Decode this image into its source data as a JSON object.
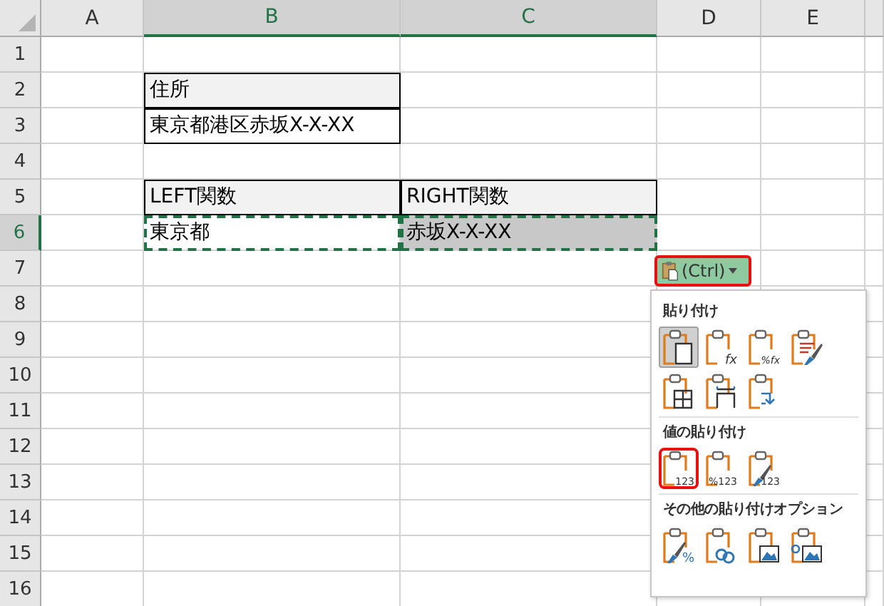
{
  "columns": [
    {
      "label": "A",
      "selected": false
    },
    {
      "label": "B",
      "selected": true
    },
    {
      "label": "C",
      "selected": true
    },
    {
      "label": "D",
      "selected": false
    },
    {
      "label": "E",
      "selected": false
    }
  ],
  "rows": [
    {
      "label": "1",
      "selected": false
    },
    {
      "label": "2",
      "selected": false,
      "cells": [
        {
          "text": "住所",
          "kind": "header",
          "shaded": false,
          "copied": false
        }
      ]
    },
    {
      "label": "3",
      "selected": false,
      "cells": [
        {
          "text": "東京都港区赤坂X-X-XX",
          "kind": "bordered",
          "shaded": false,
          "copied": false
        }
      ]
    },
    {
      "label": "4",
      "selected": false
    },
    {
      "label": "5",
      "selected": false,
      "cells": [
        {
          "text": "LEFT関数",
          "kind": "header",
          "shaded": false,
          "copied": false
        },
        {
          "text": "RIGHT関数",
          "kind": "header",
          "shaded": false,
          "copied": false
        }
      ]
    },
    {
      "label": "6",
      "selected": true,
      "cells": [
        {
          "text": "東京都",
          "kind": "bordered",
          "shaded": false,
          "copied": true
        },
        {
          "text": "赤坂X-X-XX",
          "kind": "bordered",
          "shaded": true,
          "copied": true
        }
      ]
    },
    {
      "label": "7",
      "selected": false
    },
    {
      "label": "8",
      "selected": false
    },
    {
      "label": "9",
      "selected": false
    },
    {
      "label": "10",
      "selected": false
    },
    {
      "label": "11",
      "selected": false
    },
    {
      "label": "12",
      "selected": false
    },
    {
      "label": "13",
      "selected": false
    },
    {
      "label": "14",
      "selected": false
    },
    {
      "label": "15",
      "selected": false
    },
    {
      "label": "16",
      "selected": false
    }
  ],
  "paste_button": {
    "label": "(Ctrl)",
    "annotated": true
  },
  "paste_menu": {
    "sections": [
      {
        "title": "貼り付け",
        "options": [
          {
            "kind": "paste",
            "selected": true,
            "annotated": false
          },
          {
            "kind": "formulas",
            "glyph": "fx",
            "selected": false,
            "annotated": false
          },
          {
            "kind": "formulas-format",
            "glyph": "%fx",
            "selected": false,
            "annotated": false
          },
          {
            "kind": "source-format",
            "selected": false,
            "annotated": false
          },
          {
            "kind": "no-borders",
            "selected": false,
            "annotated": false
          },
          {
            "kind": "column-widths",
            "selected": false,
            "annotated": false
          },
          {
            "kind": "transpose",
            "selected": false,
            "annotated": false
          }
        ]
      },
      {
        "title": "値の貼り付け",
        "options": [
          {
            "kind": "values",
            "glyph": "123",
            "selected": false,
            "annotated": true
          },
          {
            "kind": "values-format",
            "glyph": "%123",
            "selected": false,
            "annotated": false
          },
          {
            "kind": "values-source-format",
            "glyph": "123",
            "selected": false,
            "annotated": false
          }
        ]
      },
      {
        "title": "その他の貼り付けオプション",
        "options": [
          {
            "kind": "formatting",
            "glyph": "%",
            "selected": false,
            "annotated": false
          },
          {
            "kind": "link",
            "selected": false,
            "annotated": false
          },
          {
            "kind": "picture",
            "selected": false,
            "annotated": false
          },
          {
            "kind": "linked-picture",
            "selected": false,
            "annotated": false
          }
        ]
      }
    ]
  }
}
